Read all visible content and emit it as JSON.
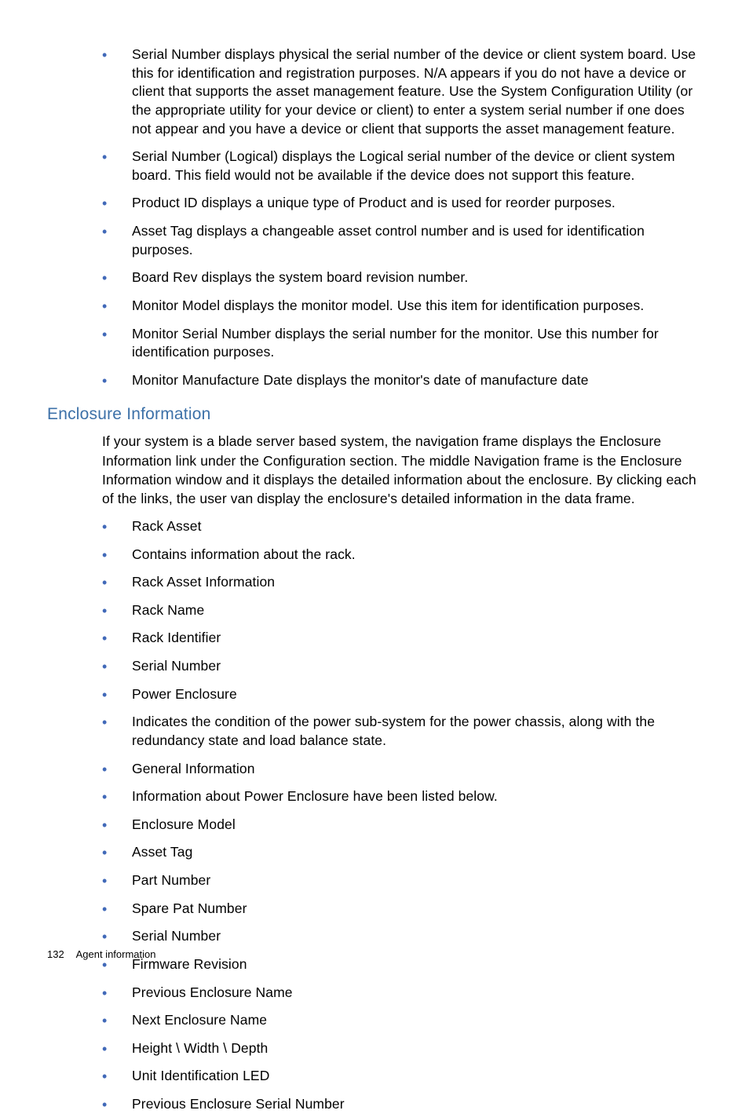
{
  "list1": {
    "items": [
      "Serial Number displays physical the serial number of the device or client system board. Use this for identification and registration purposes. N/A appears if you do not have a device or client that supports the asset management feature. Use the System Configuration Utility (or the appropriate utility for your device or client) to enter a system serial number if one does not appear and you have a device or client that supports the asset management feature.",
      "Serial Number (Logical) displays the Logical serial number of the device or client system board. This field would not be available if the device does not support this feature.",
      "Product ID displays a unique type of Product and is used for reorder purposes.",
      "Asset Tag displays a changeable asset control number and is used for identification purposes.",
      "Board Rev displays the system board revision number.",
      "Monitor Model displays the monitor model. Use this item for identification purposes.",
      "Monitor Serial Number displays the serial number for the monitor. Use this number for identification purposes.",
      "Monitor Manufacture Date displays the monitor's date of manufacture date"
    ]
  },
  "section2": {
    "heading": "Enclosure Information",
    "paragraph": "If your system is a blade server based system, the navigation frame displays the Enclosure Information link under the Configuration section. The middle Navigation frame is the Enclosure Information window and it displays the detailed information about the enclosure. By clicking each of the links, the user van display the enclosure's detailed information in the data frame.",
    "items": [
      "Rack Asset",
      "Contains information about the rack.",
      "Rack Asset Information",
      "Rack Name",
      "Rack Identifier",
      "Serial Number",
      "Power Enclosure",
      "Indicates the condition of the power sub-system for the power chassis, along with the redundancy state and load balance state.",
      "General Information",
      "Information about Power Enclosure have been listed below.",
      "Enclosure Model",
      "Asset Tag",
      "Part Number",
      "Spare Pat Number",
      "Serial Number",
      "Firmware Revision",
      "Previous Enclosure Name",
      "Next Enclosure Name",
      "Height \\ Width \\ Depth",
      "Unit Identification LED",
      "Previous Enclosure Serial Number"
    ]
  },
  "footer": {
    "page": "132",
    "title": "Agent information"
  }
}
